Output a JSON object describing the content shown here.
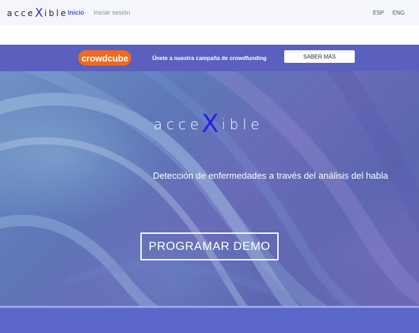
{
  "navbar": {
    "brand": {
      "prefix": "acce",
      "x": "X",
      "suffix": "ible"
    },
    "links": [
      {
        "label": "Inicio",
        "active": true
      },
      {
        "label": "Iniciar sesión",
        "active": false
      }
    ],
    "languages": [
      "ESP",
      "ENG"
    ]
  },
  "promo": {
    "logo_text": "crowdcube",
    "text": "Únete a nuestra campaña de crowdfunding",
    "button_label": "SABER MÁS"
  },
  "hero": {
    "logo": {
      "prefix": "acce",
      "x": "X",
      "suffix": "ible"
    },
    "tagline": "Detección de enfermedades a través del análisis del habla",
    "cta_label": "PROGRAMAR DEMO"
  },
  "colors": {
    "accent": "#4a57c8",
    "promo_bg": "#5b60be",
    "crowdcube_orange": "#ef6a1f",
    "logo_x": "#2222e6",
    "footer_band": "#5c68c9"
  }
}
